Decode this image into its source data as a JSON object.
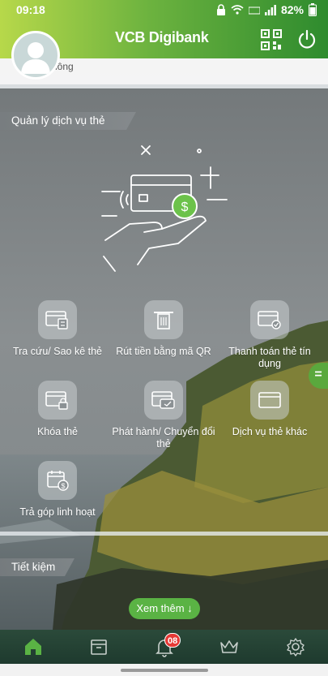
{
  "status_bar": {
    "time": "09:18",
    "battery": "82%",
    "icons": [
      "lock-icon",
      "wifi-icon",
      "volte-icon",
      "signal-icon",
      "battery-icon"
    ]
  },
  "header": {
    "brand": "VCB Digibank",
    "qr_icon": "qr-code-icon",
    "power_icon": "power-icon"
  },
  "top_card": {
    "partial_text": "hông"
  },
  "card_services": {
    "section_title": "Quản lý dịch vụ thẻ",
    "items": [
      {
        "label": "Tra cứu/ Sao kê thẻ",
        "icon": "card-statement-icon"
      },
      {
        "label": "Rút tiền bằng mã QR",
        "icon": "atm-withdraw-icon"
      },
      {
        "label": "Thanh toán thẻ tín dụng",
        "icon": "card-pay-icon"
      },
      {
        "label": "Khóa thẻ",
        "icon": "card-lock-icon"
      },
      {
        "label": "Phát hành/ Chuyển đổi thẻ",
        "icon": "card-issue-icon"
      },
      {
        "label": "Dịch vụ thẻ khác",
        "icon": "card-other-icon"
      },
      {
        "label": "Trả góp linh hoạt",
        "icon": "installment-icon"
      }
    ]
  },
  "savings": {
    "section_title": "Tiết kiệm"
  },
  "see_more": {
    "label": "Xem thêm ↓"
  },
  "side_tab": {
    "label": "="
  },
  "bottom_nav": {
    "items": [
      "home-icon",
      "inbox-icon",
      "bell-icon",
      "crown-icon",
      "settings-icon"
    ],
    "bell_badge": "08"
  },
  "colors": {
    "brand_green": "#5ab344",
    "header_left": "#b7d84a",
    "header_right": "#2e8b2e",
    "nav_bg": "#1e3a2e",
    "badge_red": "#e53935"
  }
}
